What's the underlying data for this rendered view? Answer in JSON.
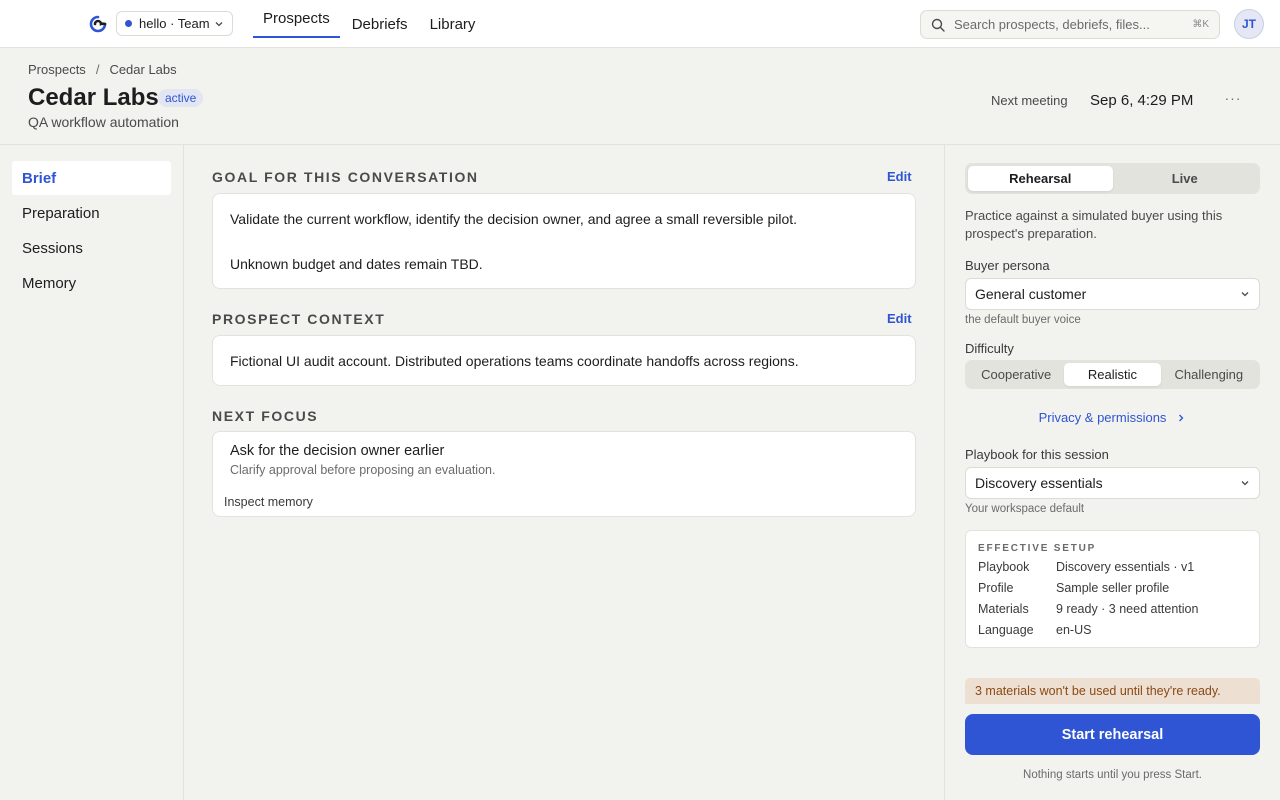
{
  "topbar": {
    "workspace_label": "hello · Team",
    "nav": [
      {
        "label": "Prospects",
        "active": true
      },
      {
        "label": "Debriefs",
        "active": false
      },
      {
        "label": "Library",
        "active": false
      }
    ],
    "search_placeholder": "Search prospects, debriefs, files...",
    "search_shortcut": "⌘K",
    "avatar_initials": "JT"
  },
  "header": {
    "breadcrumb": [
      "Prospects",
      "Cedar Labs"
    ],
    "breadcrumb_sep": "/",
    "title": "Cedar Labs",
    "status_badge": "active",
    "subtitle": "QA workflow automation",
    "next_meeting_label": "Next meeting",
    "next_meeting_value": "Sep 6, 4:29 PM",
    "more_label": "···"
  },
  "leftnav": {
    "items": [
      {
        "label": "Brief",
        "active": true
      },
      {
        "label": "Preparation",
        "active": false
      },
      {
        "label": "Sessions",
        "active": false
      },
      {
        "label": "Memory",
        "active": false
      }
    ]
  },
  "main": {
    "goal": {
      "title": "GOAL FOR THIS CONVERSATION",
      "edit_label": "Edit",
      "line1": "Validate the current workflow, identify the decision owner, and agree a small reversible pilot.",
      "line2": "Unknown budget and dates remain TBD."
    },
    "context": {
      "title": "PROSPECT CONTEXT",
      "edit_label": "Edit",
      "text": "Fictional UI audit account. Distributed operations teams coordinate handoffs across regions."
    },
    "next_focus": {
      "title": "NEXT FOCUS",
      "heading": "Ask for the decision owner earlier",
      "detail": "Clarify approval before proposing an evaluation.",
      "link": "Inspect memory"
    }
  },
  "panel": {
    "mode_tabs": [
      {
        "label": "Rehearsal",
        "active": true
      },
      {
        "label": "Live",
        "active": false
      }
    ],
    "description": "Practice against a simulated buyer using this prospect's preparation.",
    "persona_label": "Buyer persona",
    "persona_value": "General customer",
    "persona_hint": "the default buyer voice",
    "difficulty_label": "Difficulty",
    "difficulty_options": [
      {
        "label": "Cooperative",
        "active": false
      },
      {
        "label": "Realistic",
        "active": true
      },
      {
        "label": "Challenging",
        "active": false
      }
    ],
    "privacy_link": "Privacy & permissions",
    "playbook_label": "Playbook for this session",
    "playbook_value": "Discovery essentials",
    "playbook_hint": "Your workspace default",
    "setup": {
      "title": "EFFECTIVE SETUP",
      "rows": [
        {
          "key": "Playbook",
          "value": "Discovery essentials · v1"
        },
        {
          "key": "Profile",
          "value": "Sample seller profile"
        },
        {
          "key": "Materials",
          "value": "9 ready · 3 need attention"
        },
        {
          "key": "Language",
          "value": "en-US"
        }
      ]
    },
    "warning": "3 materials won't be used until they're ready.",
    "start_label": "Start rehearsal",
    "footnote": "Nothing starts until you press Start."
  },
  "colors": {
    "accent": "#2f55d4",
    "background": "#f2f2ee",
    "warning_bg": "#eddfd1",
    "warning_text": "#8a4a15"
  }
}
